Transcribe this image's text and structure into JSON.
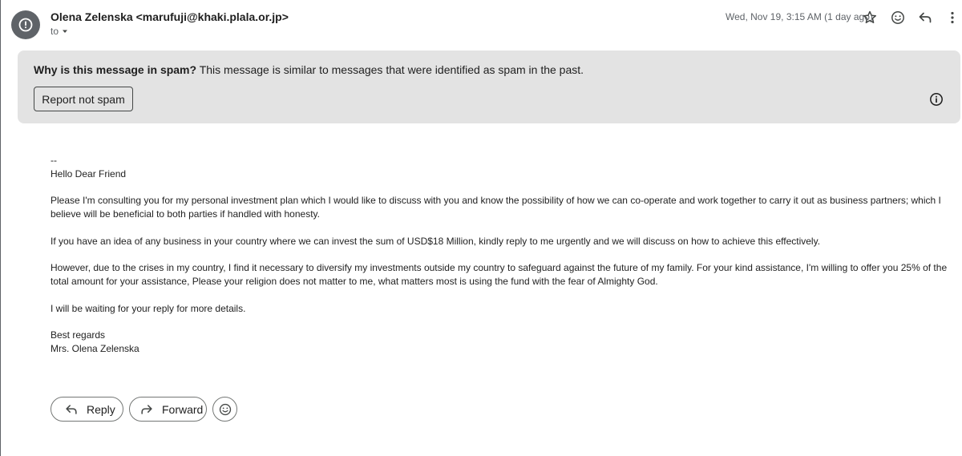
{
  "header": {
    "sender": "Olena Zelenska <marufuji@khaki.plala.or.jp>",
    "to_label": "to",
    "date": "Wed, Nov 19, 3:15 AM (1 day ago)"
  },
  "spam_notice": {
    "question": "Why is this message in spam?",
    "explanation": " This message is similar to messages that were identified as spam in the past.",
    "report_button": "Report not spam"
  },
  "body": {
    "signature_sep": "--",
    "greeting": "Hello Dear Friend",
    "paragraphs": [
      "Please I'm consulting you for my personal investment plan  which I would like to discuss with you and know the possibility of how we can co-operate and work together to carry it out as business partners; which I believe will be beneficial to both parties if handled with honesty.",
      "If you have an idea of any business in your country where we can invest the sum of USD$18 Million, kindly reply to me urgently and we will discuss on how to achieve this  effectively.",
      "However, due to the crises in my country, I find it necessary to diversify my investments outside my country to safeguard against the future of my family. For  your kind assistance, I'm willing to offer you 25% of the total amount for your assistance, Please your religion does not matter to me, what matters most is using the fund with the fear of Almighty God.",
      "I will be waiting for your reply for more details."
    ],
    "closing": "Best regards",
    "signature": "Mrs. Olena Zelenska"
  },
  "actions": {
    "reply": "Reply",
    "forward": "Forward"
  },
  "icons": {
    "avatar": "alert-icon",
    "star": "star-icon",
    "emoji": "emoji-icon",
    "reply": "reply-icon",
    "more": "more-vert-icon",
    "info": "info-icon",
    "forward": "forward-icon"
  },
  "colors": {
    "spam_banner_bg": "#e3e3e3",
    "avatar_bg": "#5f6368",
    "text": "#1f1f1f",
    "muted": "#5f6368"
  }
}
